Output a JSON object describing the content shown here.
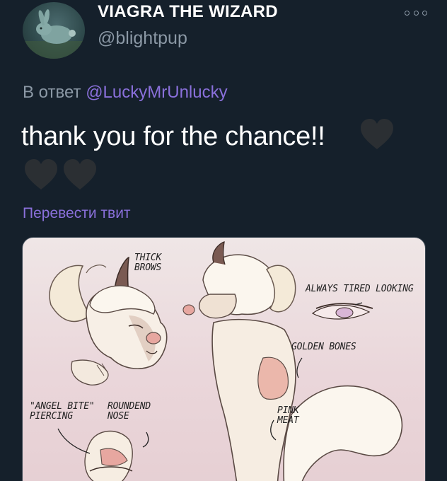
{
  "author": {
    "display_name": "VIAGRA THE WIZARD",
    "handle": "@blightpup",
    "avatar_icon": "bunny-avatar-icon"
  },
  "reply": {
    "prefix": "В ответ",
    "mention": "@LuckyMrUnlucky"
  },
  "tweet": {
    "text": "thank you for the chance!!",
    "emoji_icons": [
      "black-heart-icon",
      "black-heart-icon",
      "black-heart-icon"
    ],
    "translate_label": "Перевести твит"
  },
  "media": {
    "labels": {
      "thick_brows": "THICK BROWS",
      "always_tired": "ALWAYS TIRED LOOKING",
      "golden_bones": "GOLDEN BONES",
      "angel_bite": "\"ANGEL BITE\" PIERCING",
      "roundend_nose": "ROUNDEND NOSE",
      "pink_meat": "PINK MEAT"
    }
  },
  "colors": {
    "background": "#15202b",
    "secondary_text": "#8b98a5",
    "accent": "#8a70db",
    "heart": "#2b2f33"
  }
}
